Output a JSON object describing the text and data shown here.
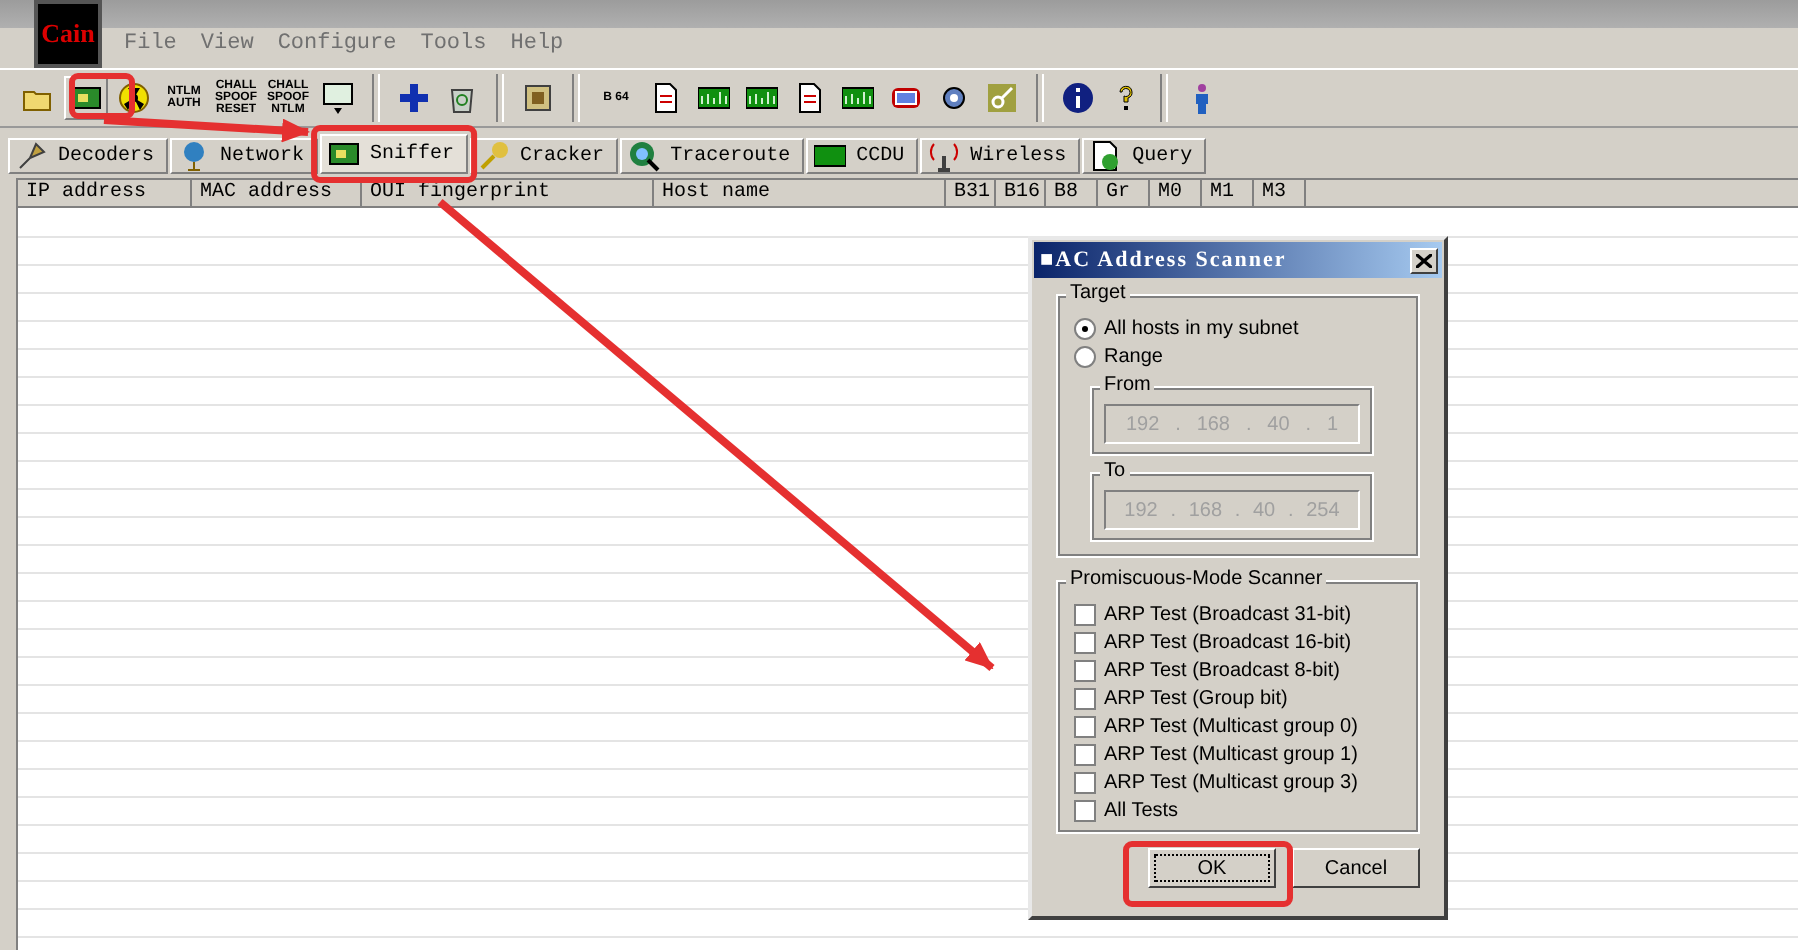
{
  "app": {
    "logo": "Cain"
  },
  "menu": [
    {
      "label": "File"
    },
    {
      "label": "View"
    },
    {
      "label": "Configure"
    },
    {
      "label": "Tools"
    },
    {
      "label": "Help"
    }
  ],
  "toolbar": [
    {
      "kind": "icon",
      "selected": false
    },
    {
      "kind": "icon",
      "selected": true
    },
    {
      "kind": "icon",
      "selected": false
    },
    {
      "kind": "text",
      "label": "NTLM AUTH"
    },
    {
      "kind": "text",
      "label": "CHALL SPOOF RESET"
    },
    {
      "kind": "text",
      "label": "CHALL SPOOF NTLM"
    },
    {
      "kind": "icon",
      "selected": false
    },
    {
      "kind": "separator"
    },
    {
      "kind": "icon",
      "selected": false
    },
    {
      "kind": "icon",
      "selected": false
    },
    {
      "kind": "separator"
    },
    {
      "kind": "icon",
      "selected": false
    },
    {
      "kind": "separator"
    },
    {
      "kind": "text",
      "label": "B 64"
    },
    {
      "kind": "icon",
      "selected": false
    },
    {
      "kind": "icon",
      "selected": false
    },
    {
      "kind": "icon",
      "selected": false
    },
    {
      "kind": "icon",
      "selected": false
    },
    {
      "kind": "icon",
      "selected": false
    },
    {
      "kind": "icon",
      "selected": false
    },
    {
      "kind": "icon",
      "selected": false
    },
    {
      "kind": "icon",
      "selected": false
    },
    {
      "kind": "separator"
    },
    {
      "kind": "icon",
      "selected": false
    },
    {
      "kind": "icon",
      "selected": false
    },
    {
      "kind": "separator"
    },
    {
      "kind": "icon",
      "selected": false
    }
  ],
  "tabs": [
    {
      "label": "Decoders",
      "selected": false
    },
    {
      "label": "Network",
      "selected": false
    },
    {
      "label": "Sniffer",
      "selected": true
    },
    {
      "label": "Cracker",
      "selected": false
    },
    {
      "label": "Traceroute",
      "selected": false
    },
    {
      "label": "CCDU",
      "selected": false
    },
    {
      "label": "Wireless",
      "selected": false
    },
    {
      "label": "Query",
      "selected": false
    }
  ],
  "table": {
    "columns": [
      "IP address",
      "MAC address",
      "OUI fingerprint",
      "Host name",
      "B31",
      "B16",
      "B8",
      "Gr",
      "M0",
      "M1",
      "M3"
    ]
  },
  "dialog": {
    "title": "■AC Address Scanner",
    "target": {
      "title": "Target",
      "options": [
        {
          "label": "All hosts in my subnet",
          "selected": true
        },
        {
          "label": "Range",
          "selected": false
        }
      ],
      "from": {
        "label": "From",
        "octets": [
          "192",
          ".",
          "168",
          ".",
          "40",
          ".",
          "1"
        ],
        "disabled": true
      },
      "to": {
        "label": "To",
        "octets": [
          "192",
          ".",
          "168",
          ".",
          "40",
          ".",
          "254"
        ],
        "disabled": true
      }
    },
    "scanner": {
      "title": "Promiscuous-Mode Scanner",
      "tests": [
        {
          "label": "ARP Test (Broadcast 31-bit)",
          "checked": false
        },
        {
          "label": "ARP Test (Broadcast 16-bit)",
          "checked": false
        },
        {
          "label": "ARP Test (Broadcast 8-bit)",
          "checked": false
        },
        {
          "label": "ARP Test (Group bit)",
          "checked": false
        },
        {
          "label": "ARP Test (Multicast group 0)",
          "checked": false
        },
        {
          "label": "ARP Test (Multicast group 1)",
          "checked": false
        },
        {
          "label": "ARP Test (Multicast group 3)",
          "checked": false
        },
        {
          "label": "All Tests",
          "checked": false
        }
      ]
    },
    "buttons": [
      {
        "label": "OK",
        "default": true
      },
      {
        "label": "Cancel",
        "default": false
      }
    ]
  }
}
